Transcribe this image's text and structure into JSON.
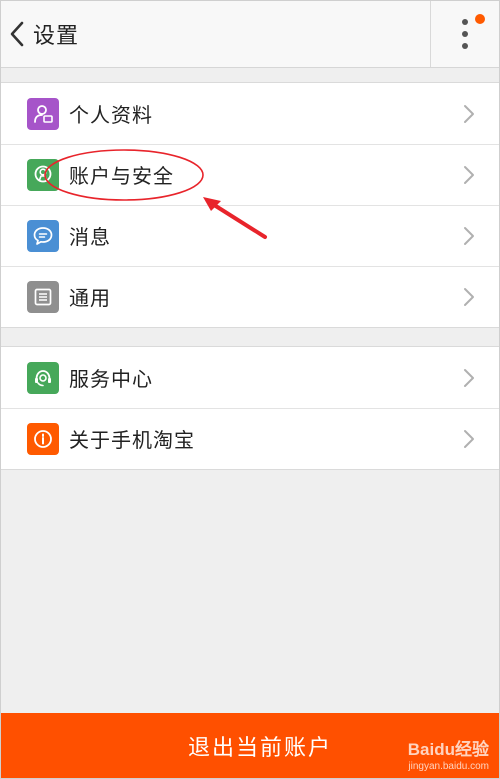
{
  "header": {
    "title": "设置",
    "has_notification_badge": true,
    "badge_color": "#ff5a00"
  },
  "groups": [
    {
      "items": [
        {
          "label": "个人资料",
          "icon": "user-card-icon",
          "color": "#a654c9"
        },
        {
          "label": "账户与安全",
          "icon": "shield-user-icon",
          "color": "#46a85a"
        },
        {
          "label": "消息",
          "icon": "chat-bubble-icon",
          "color": "#4a8fd4"
        },
        {
          "label": "通用",
          "icon": "settings-grid-icon",
          "color": "#8f8f8f"
        }
      ]
    },
    {
      "items": [
        {
          "label": "服务中心",
          "icon": "headset-icon",
          "color": "#46a85a"
        },
        {
          "label": "关于手机淘宝",
          "icon": "info-icon",
          "color": "#ff5a00"
        }
      ]
    }
  ],
  "logout": {
    "label": "退出当前账户",
    "color": "#ff5000"
  },
  "annotation": {
    "target": "账户与安全",
    "color": "#e8242b"
  },
  "watermark": {
    "main": "Baidu经验",
    "sub": "jingyan.baidu.com"
  }
}
